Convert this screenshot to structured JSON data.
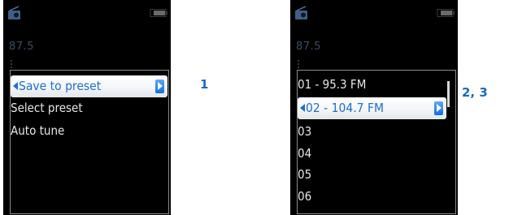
{
  "colors": {
    "screen_bg": "#000000",
    "accent_blue": "#1e6fd2",
    "freq_text": "#3a4f66",
    "label_blue": "#1b6bbf"
  },
  "screen1": {
    "frequency": "87.5",
    "menu": {
      "selected": "Save to preset",
      "items": [
        "Select preset",
        "Auto tune"
      ]
    },
    "step_label": "1"
  },
  "screen2": {
    "frequency": "87.5",
    "presets": {
      "items": [
        "01 - 95.3 FM",
        "03",
        "04",
        "05",
        "06"
      ],
      "selected": "02 - 104.7 FM"
    },
    "step_label": "2, 3"
  },
  "icons": [
    "radio-icon",
    "battery-icon",
    "left-arrow-icon",
    "right-arrow-icon"
  ]
}
